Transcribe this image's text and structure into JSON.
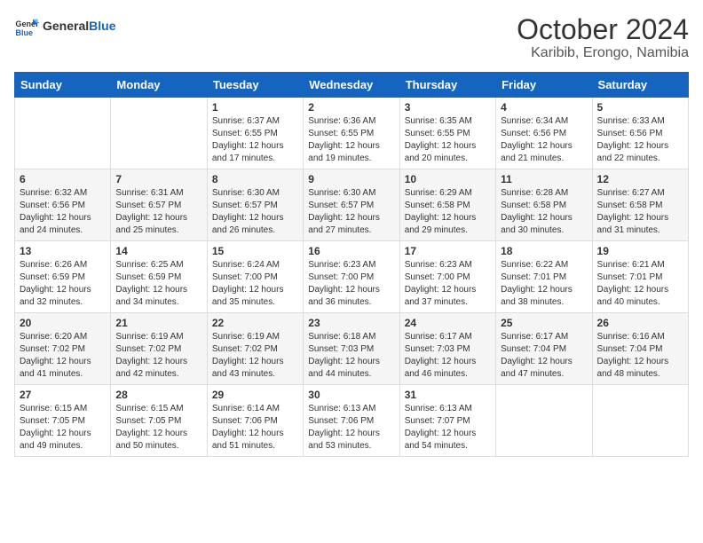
{
  "header": {
    "logo_general": "General",
    "logo_blue": "Blue",
    "month_year": "October 2024",
    "location": "Karibib, Erongo, Namibia"
  },
  "days_of_week": [
    "Sunday",
    "Monday",
    "Tuesday",
    "Wednesday",
    "Thursday",
    "Friday",
    "Saturday"
  ],
  "weeks": [
    [
      null,
      null,
      {
        "day": "1",
        "sunrise": "Sunrise: 6:37 AM",
        "sunset": "Sunset: 6:55 PM",
        "daylight": "Daylight: 12 hours and 17 minutes."
      },
      {
        "day": "2",
        "sunrise": "Sunrise: 6:36 AM",
        "sunset": "Sunset: 6:55 PM",
        "daylight": "Daylight: 12 hours and 19 minutes."
      },
      {
        "day": "3",
        "sunrise": "Sunrise: 6:35 AM",
        "sunset": "Sunset: 6:55 PM",
        "daylight": "Daylight: 12 hours and 20 minutes."
      },
      {
        "day": "4",
        "sunrise": "Sunrise: 6:34 AM",
        "sunset": "Sunset: 6:56 PM",
        "daylight": "Daylight: 12 hours and 21 minutes."
      },
      {
        "day": "5",
        "sunrise": "Sunrise: 6:33 AM",
        "sunset": "Sunset: 6:56 PM",
        "daylight": "Daylight: 12 hours and 22 minutes."
      }
    ],
    [
      {
        "day": "6",
        "sunrise": "Sunrise: 6:32 AM",
        "sunset": "Sunset: 6:56 PM",
        "daylight": "Daylight: 12 hours and 24 minutes."
      },
      {
        "day": "7",
        "sunrise": "Sunrise: 6:31 AM",
        "sunset": "Sunset: 6:57 PM",
        "daylight": "Daylight: 12 hours and 25 minutes."
      },
      {
        "day": "8",
        "sunrise": "Sunrise: 6:30 AM",
        "sunset": "Sunset: 6:57 PM",
        "daylight": "Daylight: 12 hours and 26 minutes."
      },
      {
        "day": "9",
        "sunrise": "Sunrise: 6:30 AM",
        "sunset": "Sunset: 6:57 PM",
        "daylight": "Daylight: 12 hours and 27 minutes."
      },
      {
        "day": "10",
        "sunrise": "Sunrise: 6:29 AM",
        "sunset": "Sunset: 6:58 PM",
        "daylight": "Daylight: 12 hours and 29 minutes."
      },
      {
        "day": "11",
        "sunrise": "Sunrise: 6:28 AM",
        "sunset": "Sunset: 6:58 PM",
        "daylight": "Daylight: 12 hours and 30 minutes."
      },
      {
        "day": "12",
        "sunrise": "Sunrise: 6:27 AM",
        "sunset": "Sunset: 6:58 PM",
        "daylight": "Daylight: 12 hours and 31 minutes."
      }
    ],
    [
      {
        "day": "13",
        "sunrise": "Sunrise: 6:26 AM",
        "sunset": "Sunset: 6:59 PM",
        "daylight": "Daylight: 12 hours and 32 minutes."
      },
      {
        "day": "14",
        "sunrise": "Sunrise: 6:25 AM",
        "sunset": "Sunset: 6:59 PM",
        "daylight": "Daylight: 12 hours and 34 minutes."
      },
      {
        "day": "15",
        "sunrise": "Sunrise: 6:24 AM",
        "sunset": "Sunset: 7:00 PM",
        "daylight": "Daylight: 12 hours and 35 minutes."
      },
      {
        "day": "16",
        "sunrise": "Sunrise: 6:23 AM",
        "sunset": "Sunset: 7:00 PM",
        "daylight": "Daylight: 12 hours and 36 minutes."
      },
      {
        "day": "17",
        "sunrise": "Sunrise: 6:23 AM",
        "sunset": "Sunset: 7:00 PM",
        "daylight": "Daylight: 12 hours and 37 minutes."
      },
      {
        "day": "18",
        "sunrise": "Sunrise: 6:22 AM",
        "sunset": "Sunset: 7:01 PM",
        "daylight": "Daylight: 12 hours and 38 minutes."
      },
      {
        "day": "19",
        "sunrise": "Sunrise: 6:21 AM",
        "sunset": "Sunset: 7:01 PM",
        "daylight": "Daylight: 12 hours and 40 minutes."
      }
    ],
    [
      {
        "day": "20",
        "sunrise": "Sunrise: 6:20 AM",
        "sunset": "Sunset: 7:02 PM",
        "daylight": "Daylight: 12 hours and 41 minutes."
      },
      {
        "day": "21",
        "sunrise": "Sunrise: 6:19 AM",
        "sunset": "Sunset: 7:02 PM",
        "daylight": "Daylight: 12 hours and 42 minutes."
      },
      {
        "day": "22",
        "sunrise": "Sunrise: 6:19 AM",
        "sunset": "Sunset: 7:02 PM",
        "daylight": "Daylight: 12 hours and 43 minutes."
      },
      {
        "day": "23",
        "sunrise": "Sunrise: 6:18 AM",
        "sunset": "Sunset: 7:03 PM",
        "daylight": "Daylight: 12 hours and 44 minutes."
      },
      {
        "day": "24",
        "sunrise": "Sunrise: 6:17 AM",
        "sunset": "Sunset: 7:03 PM",
        "daylight": "Daylight: 12 hours and 46 minutes."
      },
      {
        "day": "25",
        "sunrise": "Sunrise: 6:17 AM",
        "sunset": "Sunset: 7:04 PM",
        "daylight": "Daylight: 12 hours and 47 minutes."
      },
      {
        "day": "26",
        "sunrise": "Sunrise: 6:16 AM",
        "sunset": "Sunset: 7:04 PM",
        "daylight": "Daylight: 12 hours and 48 minutes."
      }
    ],
    [
      {
        "day": "27",
        "sunrise": "Sunrise: 6:15 AM",
        "sunset": "Sunset: 7:05 PM",
        "daylight": "Daylight: 12 hours and 49 minutes."
      },
      {
        "day": "28",
        "sunrise": "Sunrise: 6:15 AM",
        "sunset": "Sunset: 7:05 PM",
        "daylight": "Daylight: 12 hours and 50 minutes."
      },
      {
        "day": "29",
        "sunrise": "Sunrise: 6:14 AM",
        "sunset": "Sunset: 7:06 PM",
        "daylight": "Daylight: 12 hours and 51 minutes."
      },
      {
        "day": "30",
        "sunrise": "Sunrise: 6:13 AM",
        "sunset": "Sunset: 7:06 PM",
        "daylight": "Daylight: 12 hours and 53 minutes."
      },
      {
        "day": "31",
        "sunrise": "Sunrise: 6:13 AM",
        "sunset": "Sunset: 7:07 PM",
        "daylight": "Daylight: 12 hours and 54 minutes."
      },
      null,
      null
    ]
  ]
}
